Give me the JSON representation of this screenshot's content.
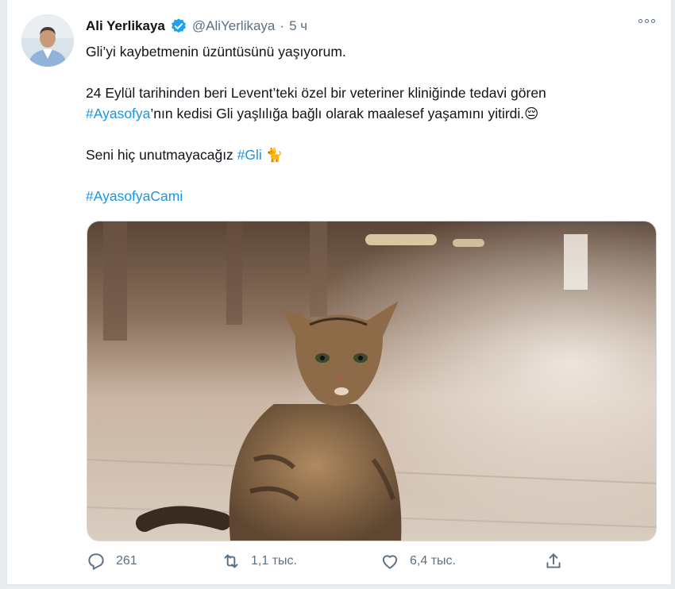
{
  "tweet": {
    "author_name": "Ali Yerlikaya",
    "handle": "@AliYerlikaya",
    "separator": "·",
    "time": "5 ч",
    "line1": "Gli’yi kaybetmenin üzüntüsünü yaşıyorum.",
    "line2": "24 Eylül tarihinden beri Levent’teki özel bir veteriner kliniğinde tedavi gören",
    "tag1": "#Ayasofya",
    "line3_rest": "’nın kedisi Gli yaşlılığa bağlı olarak maalesef yaşamını yitirdi.",
    "emoji1": "😔",
    "line4": "Seni hiç unutmayacağız ",
    "tag2": "#Gli",
    "emoji2": "🐈",
    "tag3": "#AyasofyaCami"
  },
  "actions": {
    "replies": "261",
    "retweets": "1,1 тыс.",
    "likes": "6,4 тыс."
  },
  "icons": [
    "verified-badge-icon",
    "more-icon",
    "reply-icon",
    "retweet-icon",
    "like-icon",
    "share-icon"
  ],
  "colors": {
    "accent": "#1b95e0",
    "muted": "#5b7083",
    "verified": "#1da1f2"
  }
}
